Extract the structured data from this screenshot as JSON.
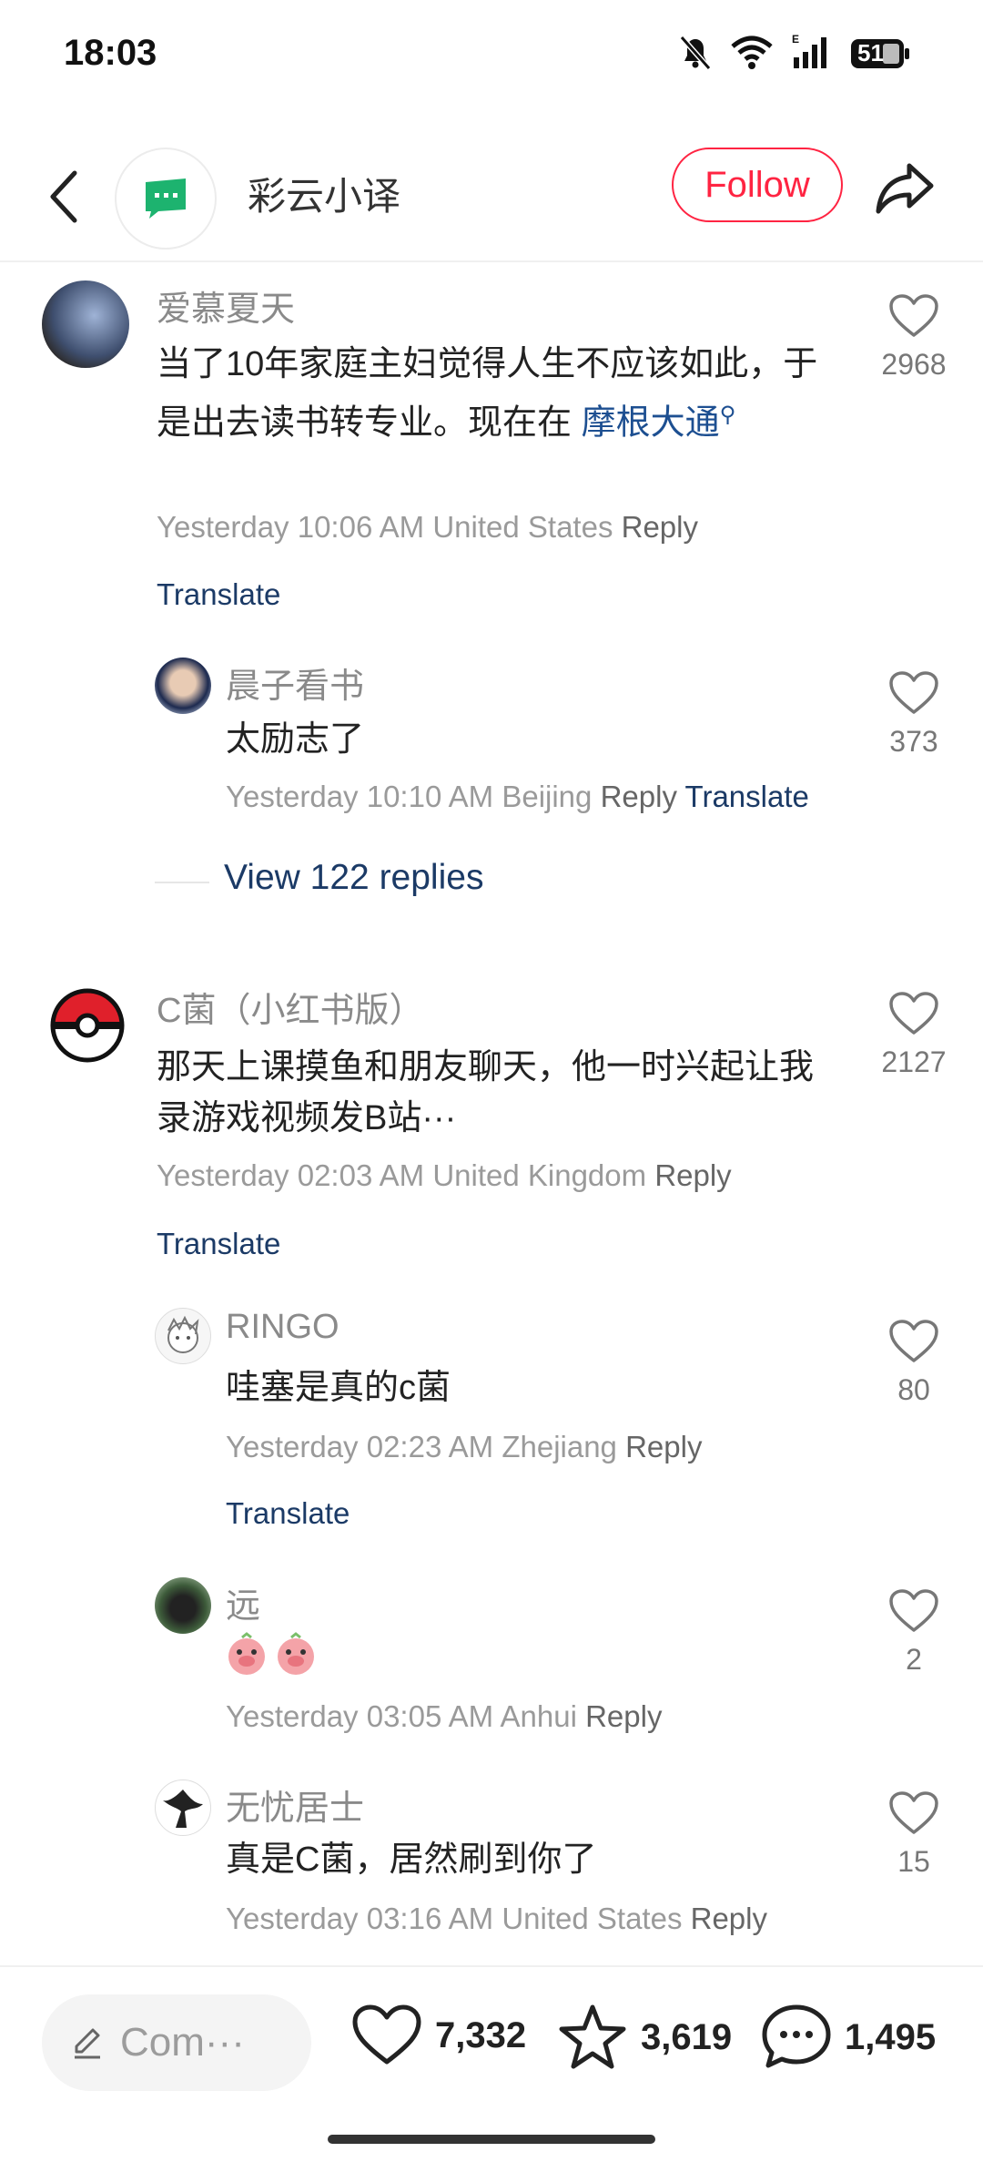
{
  "status_bar": {
    "time": "18:03",
    "battery": "51"
  },
  "header": {
    "account_name": "彩云小译",
    "follow_label": "Follow"
  },
  "comments": [
    {
      "author": "爱慕夏天",
      "text": "当了10年家庭主妇觉得人生不应该如此，于是出去读书转专业。现在在 ",
      "link": "摩根大通",
      "time": "Yesterday 10:06 AM",
      "location": "United States",
      "reply_label": "Reply",
      "translate_label": "Translate",
      "likes": "2968"
    },
    {
      "author": "晨子看书",
      "text": "太励志了",
      "time": "Yesterday 10:10 AM",
      "location": "Beijing",
      "reply_label": "Reply",
      "translate_label": "Translate",
      "likes": "373"
    },
    {
      "author": "C菌（小红书版）",
      "text": "那天上课摸鱼和朋友聊天，他一时兴起让我录游戏视频发B站···",
      "time": "Yesterday 02:03 AM",
      "location": "United Kingdom",
      "reply_label": "Reply",
      "translate_label": "Translate",
      "likes": "2127"
    },
    {
      "author": "RINGO",
      "text": "哇塞是真的c菌",
      "time": "Yesterday 02:23 AM",
      "location": "Zhejiang",
      "reply_label": "Reply",
      "translate_label": "Translate",
      "likes": "80"
    },
    {
      "author": "远",
      "time": "Yesterday 03:05 AM",
      "location": "Anhui",
      "reply_label": "Reply",
      "likes": "2"
    },
    {
      "author": "无忧居士",
      "text": "真是C菌，居然刷到你了",
      "time": "Yesterday 03:16 AM",
      "location": "United States",
      "reply_label": "Reply",
      "likes": "15"
    }
  ],
  "view_replies": "View 122 replies",
  "bottom_bar": {
    "comment_placeholder": "Com···",
    "likes": "7,332",
    "stars": "3,619",
    "comments": "1,495"
  },
  "colors": {
    "accent": "#ff2442",
    "link": "#1d4f91",
    "translate": "#1b3a66"
  }
}
